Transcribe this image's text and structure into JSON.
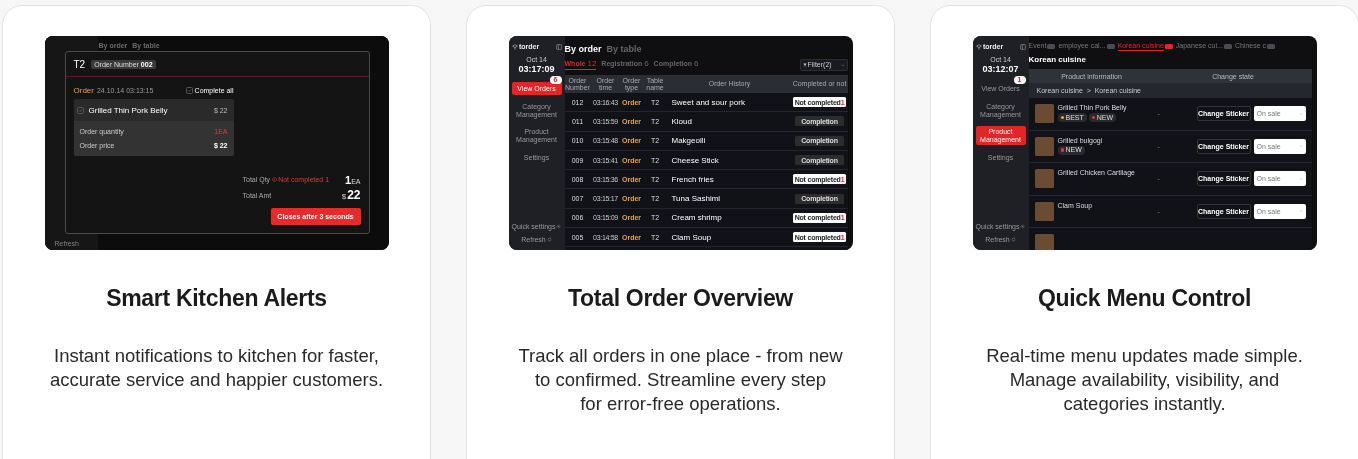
{
  "cards": [
    {
      "kind": "alert",
      "title": "Smart Kitchen Alerts",
      "description": "Instant notifications to kitchen for faster,\naccurate service and happier customers.",
      "screen": {
        "background": {
          "views": [
            "By order",
            "By table"
          ],
          "refresh": "Refresh"
        },
        "modal": {
          "table": "T2",
          "order_number_label": "Order Number",
          "order_number": "002",
          "section": "Order",
          "time": "24.10.14 03:13:15",
          "complete_all": {
            "label": "Complete all",
            "checked": false
          },
          "item": {
            "name": "Grilled Thin Pork Belly",
            "price": "$ 22",
            "checked": false,
            "details": [
              {
                "label": "Order quantity",
                "value": "1EA",
                "kind": "alert"
              },
              {
                "label": "Order price",
                "value": "$ 22",
                "kind": "plain"
              }
            ]
          },
          "total_qty": {
            "label": "Total Qty",
            "warning": "Not completed 1",
            "value": "1",
            "unit": "EA"
          },
          "total_amt": {
            "label": "Total Amt",
            "currency": "$",
            "value": "22"
          },
          "close_button": "Closes after 3 seconds"
        }
      }
    },
    {
      "kind": "orders",
      "title": "Total Order Overview",
      "description": "Track all orders in one place - from new\nto confirmed. Streamline every step\nfor error-free operations.",
      "screen": {
        "sidebar": {
          "logo": "torder",
          "date": "Oct 14",
          "time": "03:17:09",
          "items": [
            {
              "label": "View Orders",
              "badge": "6",
              "selected": true
            },
            {
              "label": "Category Management",
              "selected": false
            },
            {
              "label": "Product Management",
              "selected": false
            },
            {
              "label": "Settings",
              "selected": false
            }
          ],
          "quick_settings": "Quick settings",
          "refresh": "Refresh"
        },
        "views": [
          {
            "label": "By order",
            "selected": true
          },
          {
            "label": "By table",
            "selected": false
          }
        ],
        "tabs": [
          {
            "label": "Whole",
            "count": "12",
            "selected": true
          },
          {
            "label": "Registration",
            "count": "6",
            "selected": false
          },
          {
            "label": "Completion",
            "count": "6",
            "selected": false
          }
        ],
        "filter": "Filter(2)",
        "table": {
          "columns": [
            "Order Number",
            "Order time",
            "Order type",
            "Table name",
            "Order History",
            "Completed or not"
          ],
          "rows": [
            {
              "number": "012",
              "time": "03:16:43",
              "type": "Order",
              "table": "T2",
              "item": "Sweet and sour pork",
              "status": "Not completed",
              "count": "1",
              "completed": false
            },
            {
              "number": "011",
              "time": "03:15:59",
              "type": "Order",
              "table": "T2",
              "item": "Kloud",
              "status": "Completion",
              "completed": true
            },
            {
              "number": "010",
              "time": "03:15:48",
              "type": "Order",
              "table": "T2",
              "item": "Makgeolli",
              "status": "Completion",
              "completed": true
            },
            {
              "number": "009",
              "time": "03:15:41",
              "type": "Order",
              "table": "T2",
              "item": "Cheese Stick",
              "status": "Completion",
              "completed": true
            },
            {
              "number": "008",
              "time": "03:15:36",
              "type": "Order",
              "table": "T2",
              "item": "French fries",
              "status": "Not completed",
              "count": "1",
              "completed": false
            },
            {
              "number": "007",
              "time": "03:15:17",
              "type": "Order",
              "table": "T2",
              "item": "Tuna Sashimi",
              "status": "Completion",
              "completed": true
            },
            {
              "number": "006",
              "time": "03:15:09",
              "type": "Order",
              "table": "T2",
              "item": "Cream shrimp",
              "status": "Not completed",
              "count": "1",
              "completed": false
            },
            {
              "number": "005",
              "time": "03:14:58",
              "type": "Order",
              "table": "T2",
              "item": "Clam Soup",
              "status": "Not completed",
              "count": "1",
              "completed": false
            }
          ]
        }
      }
    },
    {
      "kind": "menu",
      "title": "Quick Menu Control",
      "description": "Real-time menu updates made simple.\nManage availability, visibility, and\ncategories instantly.",
      "screen": {
        "sidebar": {
          "logo": "torder",
          "date": "Oct 14",
          "time": "03:12:07",
          "items": [
            {
              "label": "View Orders",
              "badge": "1",
              "selected": false
            },
            {
              "label": "Category Management",
              "selected": false
            },
            {
              "label": "Product Management",
              "selected": true
            },
            {
              "label": "Settings",
              "selected": false
            }
          ],
          "quick_settings": "Quick settings",
          "refresh": "Refresh"
        },
        "tabs": [
          {
            "label": "Event",
            "selected": false
          },
          {
            "label": "employee cal...",
            "selected": false
          },
          {
            "label": "Korean cuisine",
            "selected": true
          },
          {
            "label": "Japanese cui...",
            "selected": false
          },
          {
            "label": "Chinese c",
            "selected": false
          }
        ],
        "heading": "Korean cuisine",
        "columns": [
          "Product information",
          "Change state"
        ],
        "breadcrumb": "Korean cuisine  >  Korean cuisine",
        "rows": [
          {
            "name": "Grilled Thin Pork Belly",
            "stickers": [
              {
                "label": "BEST",
                "color": "#e8b431"
              },
              {
                "label": "NEW",
                "color": "#e53935"
              }
            ],
            "dash": "-",
            "sticker_button": "Change Sticker",
            "state": "On sale"
          },
          {
            "name": "Grilled bulgogi",
            "stickers": [
              {
                "label": "NEW",
                "color": "#e53935"
              }
            ],
            "dash": "-",
            "sticker_button": "Change Sticker",
            "state": "On sale"
          },
          {
            "name": "Grilled Chicken Cartilage",
            "stickers": [],
            "dash": "-",
            "sticker_button": "Change Sticker",
            "state": "On sale"
          },
          {
            "name": "Clam Soup",
            "stickers": [],
            "dash": "-",
            "sticker_button": "Change Sticker",
            "state": "On sale"
          }
        ]
      }
    }
  ]
}
